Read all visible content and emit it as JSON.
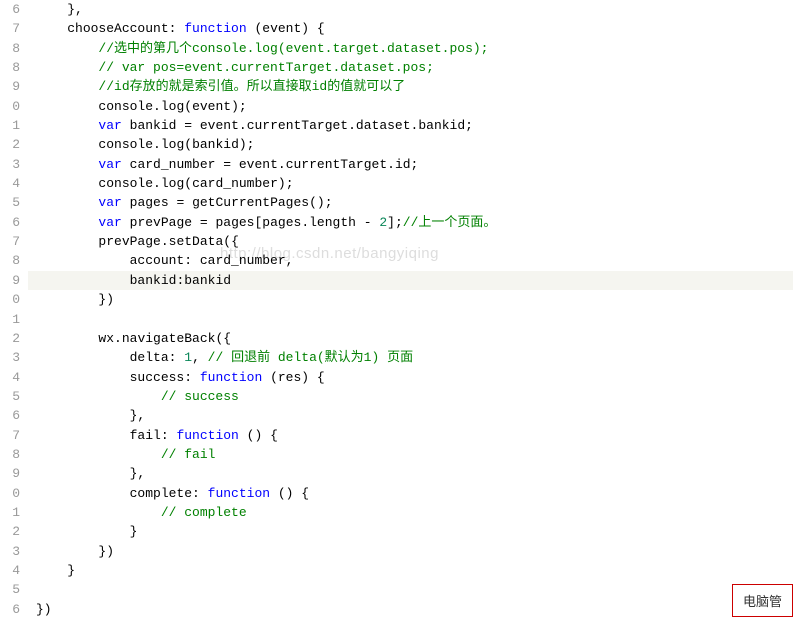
{
  "watermark": "http://blog.csdn.net/bangyiqing",
  "popup_text": "电脑管",
  "lines": [
    {
      "n": "6",
      "indent": 1,
      "tokens": [
        {
          "t": "punct",
          "v": "},"
        }
      ]
    },
    {
      "n": "7",
      "indent": 1,
      "tokens": [
        {
          "t": "ident",
          "v": "chooseAccount"
        },
        {
          "t": "punct",
          "v": ": "
        },
        {
          "t": "kw",
          "v": "function"
        },
        {
          "t": "punct",
          "v": " ("
        },
        {
          "t": "ident",
          "v": "event"
        },
        {
          "t": "punct",
          "v": ") {"
        }
      ]
    },
    {
      "n": "8",
      "indent": 2,
      "tokens": [
        {
          "t": "comment",
          "v": "//选中的第几个console.log(event.target.dataset.pos);"
        }
      ]
    },
    {
      "n": "8",
      "indent": 2,
      "tokens": [
        {
          "t": "comment",
          "v": "// var pos=event.currentTarget.dataset.pos;"
        }
      ]
    },
    {
      "n": "9",
      "indent": 2,
      "tokens": [
        {
          "t": "comment",
          "v": "//id存放的就是索引值。所以直接取id的值就可以了"
        }
      ]
    },
    {
      "n": "0",
      "indent": 2,
      "tokens": [
        {
          "t": "ident",
          "v": "console"
        },
        {
          "t": "punct",
          "v": "."
        },
        {
          "t": "ident",
          "v": "log"
        },
        {
          "t": "punct",
          "v": "("
        },
        {
          "t": "ident",
          "v": "event"
        },
        {
          "t": "punct",
          "v": ");"
        }
      ]
    },
    {
      "n": "1",
      "indent": 2,
      "tokens": [
        {
          "t": "kw",
          "v": "var"
        },
        {
          "t": "punct",
          "v": " "
        },
        {
          "t": "ident",
          "v": "bankid"
        },
        {
          "t": "punct",
          "v": " = "
        },
        {
          "t": "ident",
          "v": "event"
        },
        {
          "t": "punct",
          "v": "."
        },
        {
          "t": "ident",
          "v": "currentTarget"
        },
        {
          "t": "punct",
          "v": "."
        },
        {
          "t": "ident",
          "v": "dataset"
        },
        {
          "t": "punct",
          "v": "."
        },
        {
          "t": "ident",
          "v": "bankid"
        },
        {
          "t": "punct",
          "v": ";"
        }
      ]
    },
    {
      "n": "2",
      "indent": 2,
      "tokens": [
        {
          "t": "ident",
          "v": "console"
        },
        {
          "t": "punct",
          "v": "."
        },
        {
          "t": "ident",
          "v": "log"
        },
        {
          "t": "punct",
          "v": "("
        },
        {
          "t": "ident",
          "v": "bankid"
        },
        {
          "t": "punct",
          "v": ");"
        }
      ]
    },
    {
      "n": "3",
      "indent": 2,
      "tokens": [
        {
          "t": "kw",
          "v": "var"
        },
        {
          "t": "punct",
          "v": " "
        },
        {
          "t": "ident",
          "v": "card_number"
        },
        {
          "t": "punct",
          "v": " = "
        },
        {
          "t": "ident",
          "v": "event"
        },
        {
          "t": "punct",
          "v": "."
        },
        {
          "t": "ident",
          "v": "currentTarget"
        },
        {
          "t": "punct",
          "v": "."
        },
        {
          "t": "ident",
          "v": "id"
        },
        {
          "t": "punct",
          "v": ";"
        }
      ]
    },
    {
      "n": "4",
      "indent": 2,
      "tokens": [
        {
          "t": "ident",
          "v": "console"
        },
        {
          "t": "punct",
          "v": "."
        },
        {
          "t": "ident",
          "v": "log"
        },
        {
          "t": "punct",
          "v": "("
        },
        {
          "t": "ident",
          "v": "card_number"
        },
        {
          "t": "punct",
          "v": ");"
        }
      ]
    },
    {
      "n": "5",
      "indent": 2,
      "tokens": [
        {
          "t": "kw",
          "v": "var"
        },
        {
          "t": "punct",
          "v": " "
        },
        {
          "t": "ident",
          "v": "pages"
        },
        {
          "t": "punct",
          "v": " = "
        },
        {
          "t": "ident",
          "v": "getCurrentPages"
        },
        {
          "t": "punct",
          "v": "();"
        }
      ]
    },
    {
      "n": "6",
      "indent": 2,
      "tokens": [
        {
          "t": "kw",
          "v": "var"
        },
        {
          "t": "punct",
          "v": " "
        },
        {
          "t": "ident",
          "v": "prevPage"
        },
        {
          "t": "punct",
          "v": " = "
        },
        {
          "t": "ident",
          "v": "pages"
        },
        {
          "t": "punct",
          "v": "["
        },
        {
          "t": "ident",
          "v": "pages"
        },
        {
          "t": "punct",
          "v": "."
        },
        {
          "t": "ident",
          "v": "length"
        },
        {
          "t": "punct",
          "v": " - "
        },
        {
          "t": "num",
          "v": "2"
        },
        {
          "t": "punct",
          "v": "];"
        },
        {
          "t": "comment",
          "v": "//上一个页面。"
        }
      ]
    },
    {
      "n": "7",
      "indent": 2,
      "tokens": [
        {
          "t": "ident",
          "v": "prevPage"
        },
        {
          "t": "punct",
          "v": "."
        },
        {
          "t": "ident",
          "v": "setData"
        },
        {
          "t": "punct",
          "v": "({"
        }
      ]
    },
    {
      "n": "8",
      "indent": 3,
      "tokens": [
        {
          "t": "ident",
          "v": "account"
        },
        {
          "t": "punct",
          "v": ": "
        },
        {
          "t": "ident",
          "v": "card_number"
        },
        {
          "t": "punct",
          "v": ","
        }
      ]
    },
    {
      "n": "9",
      "indent": 3,
      "tokens": [
        {
          "t": "ident",
          "v": "bankid"
        },
        {
          "t": "punct",
          "v": ":"
        },
        {
          "t": "ident",
          "v": "bankid"
        }
      ],
      "hl": true
    },
    {
      "n": "0",
      "indent": 2,
      "tokens": [
        {
          "t": "punct",
          "v": "})"
        }
      ]
    },
    {
      "n": "1",
      "indent": 0,
      "tokens": []
    },
    {
      "n": "2",
      "indent": 2,
      "tokens": [
        {
          "t": "ident",
          "v": "wx"
        },
        {
          "t": "punct",
          "v": "."
        },
        {
          "t": "ident",
          "v": "navigateBack"
        },
        {
          "t": "punct",
          "v": "({"
        }
      ]
    },
    {
      "n": "3",
      "indent": 3,
      "tokens": [
        {
          "t": "ident",
          "v": "delta"
        },
        {
          "t": "punct",
          "v": ": "
        },
        {
          "t": "num",
          "v": "1"
        },
        {
          "t": "punct",
          "v": ", "
        },
        {
          "t": "comment",
          "v": "// 回退前 delta(默认为1) 页面"
        }
      ]
    },
    {
      "n": "4",
      "indent": 3,
      "tokens": [
        {
          "t": "ident",
          "v": "success"
        },
        {
          "t": "punct",
          "v": ": "
        },
        {
          "t": "kw",
          "v": "function"
        },
        {
          "t": "punct",
          "v": " ("
        },
        {
          "t": "ident",
          "v": "res"
        },
        {
          "t": "punct",
          "v": ") {"
        }
      ]
    },
    {
      "n": "5",
      "indent": 4,
      "tokens": [
        {
          "t": "comment",
          "v": "// success"
        }
      ]
    },
    {
      "n": "6",
      "indent": 3,
      "tokens": [
        {
          "t": "punct",
          "v": "},"
        }
      ]
    },
    {
      "n": "7",
      "indent": 3,
      "tokens": [
        {
          "t": "ident",
          "v": "fail"
        },
        {
          "t": "punct",
          "v": ": "
        },
        {
          "t": "kw",
          "v": "function"
        },
        {
          "t": "punct",
          "v": " () {"
        }
      ]
    },
    {
      "n": "8",
      "indent": 4,
      "tokens": [
        {
          "t": "comment",
          "v": "// fail"
        }
      ]
    },
    {
      "n": "9",
      "indent": 3,
      "tokens": [
        {
          "t": "punct",
          "v": "},"
        }
      ]
    },
    {
      "n": "0",
      "indent": 3,
      "tokens": [
        {
          "t": "ident",
          "v": "complete"
        },
        {
          "t": "punct",
          "v": ": "
        },
        {
          "t": "kw",
          "v": "function"
        },
        {
          "t": "punct",
          "v": " () {"
        }
      ]
    },
    {
      "n": "1",
      "indent": 4,
      "tokens": [
        {
          "t": "comment",
          "v": "// complete"
        }
      ]
    },
    {
      "n": "2",
      "indent": 3,
      "tokens": [
        {
          "t": "punct",
          "v": "}"
        }
      ]
    },
    {
      "n": "3",
      "indent": 2,
      "tokens": [
        {
          "t": "punct",
          "v": "})"
        }
      ]
    },
    {
      "n": "4",
      "indent": 1,
      "tokens": [
        {
          "t": "punct",
          "v": "}"
        }
      ]
    },
    {
      "n": "5",
      "indent": 0,
      "tokens": []
    },
    {
      "n": "6",
      "indent": 0,
      "tokens": [
        {
          "t": "punct",
          "v": "})"
        }
      ]
    }
  ]
}
